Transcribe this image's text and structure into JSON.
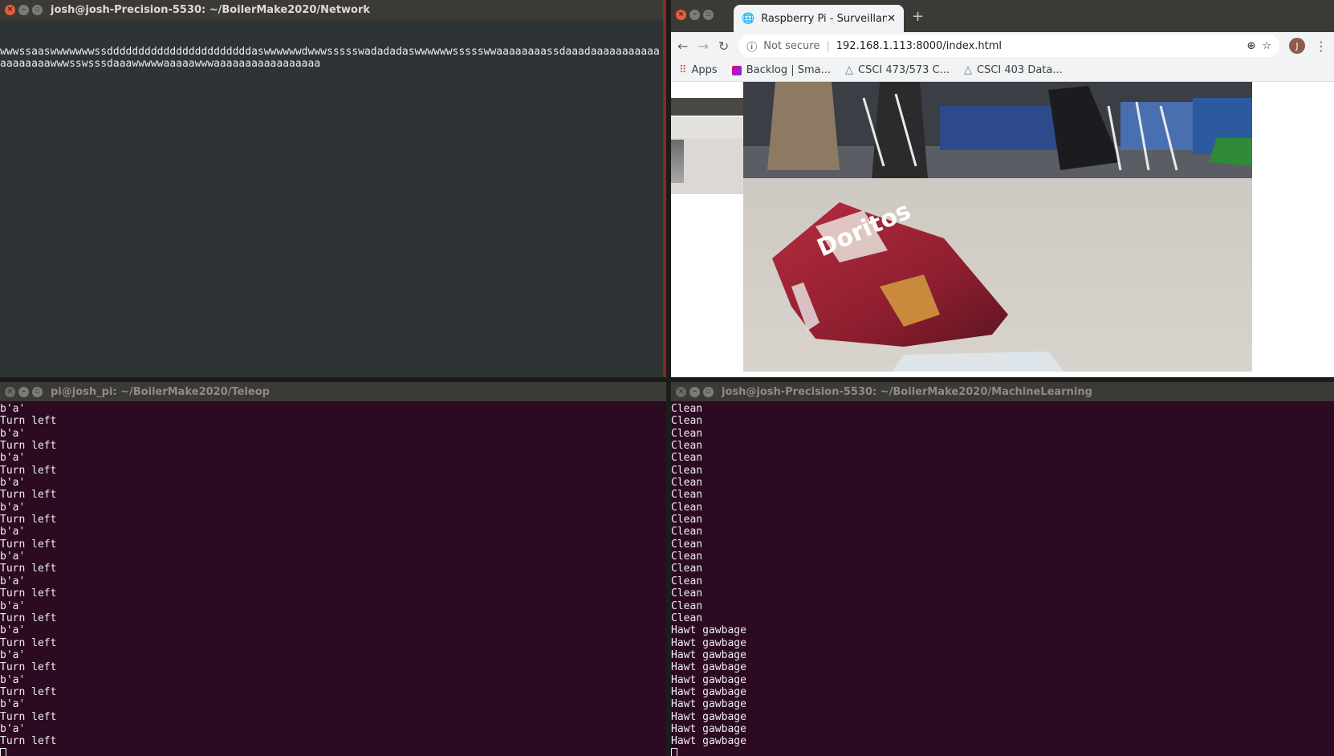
{
  "terminal_network": {
    "title": "josh@josh-Precision-5530: ~/BoilerMake2020/Network",
    "output": "wwwssaaswwwwwwwssdddddddddddddddddddddddaswwwwwwdwwwssssswadadadaswwwwwwssssswwaaaaaaaassdaaadaaaaaaaaaaaaaaaaaaawwwsswsssdaaawwwwwaaaaawwwaaaaaaaaaaaaaaaaa"
  },
  "terminal_teleop": {
    "title": "pi@josh_pi: ~/BoilerMake2020/Teleop",
    "lines": [
      "b'a'",
      "Turn left",
      "b'a'",
      "Turn left",
      "b'a'",
      "Turn left",
      "b'a'",
      "Turn left",
      "b'a'",
      "Turn left",
      "b'a'",
      "Turn left",
      "b'a'",
      "Turn left",
      "b'a'",
      "Turn left",
      "b'a'",
      "Turn left",
      "b'a'",
      "Turn left",
      "b'a'",
      "Turn left",
      "b'a'",
      "Turn left",
      "b'a'",
      "Turn left",
      "b'a'",
      "Turn left"
    ]
  },
  "terminal_ml": {
    "title": "josh@josh-Precision-5530: ~/BoilerMake2020/MachineLearning",
    "lines": [
      "Clean",
      "Clean",
      "Clean",
      "Clean",
      "Clean",
      "Clean",
      "Clean",
      "Clean",
      "Clean",
      "Clean",
      "Clean",
      "Clean",
      "Clean",
      "Clean",
      "Clean",
      "Clean",
      "Clean",
      "Clean",
      "Hawt gawbage",
      "Hawt gawbage",
      "Hawt gawbage",
      "Hawt gawbage",
      "Hawt gawbage",
      "Hawt gawbage",
      "Hawt gawbage",
      "Hawt gawbage",
      "Hawt gawbage",
      "Hawt gawbage"
    ]
  },
  "browser": {
    "tab_title": "Raspberry Pi - Surveillance",
    "not_secure": "Not secure",
    "url": "192.168.1.113:8000/index.html",
    "profile_initial": "J",
    "bookmarks": [
      {
        "label": "Apps",
        "icon": "apps-grid-icon"
      },
      {
        "label": "Backlog | Sma...",
        "icon": "backlog-icon"
      },
      {
        "label": "CSCI 473/573 C...",
        "icon": "canvas-triangle-icon"
      },
      {
        "label": "CSCI 403 Data...",
        "icon": "canvas-triangle-icon"
      }
    ],
    "video_logo_text": "Doritos"
  },
  "colors": {
    "terminal_grey": "#2e3436",
    "terminal_purple": "#2c0a22",
    "titlebar": "#3b3a36",
    "close_button": "#e45e3f"
  }
}
